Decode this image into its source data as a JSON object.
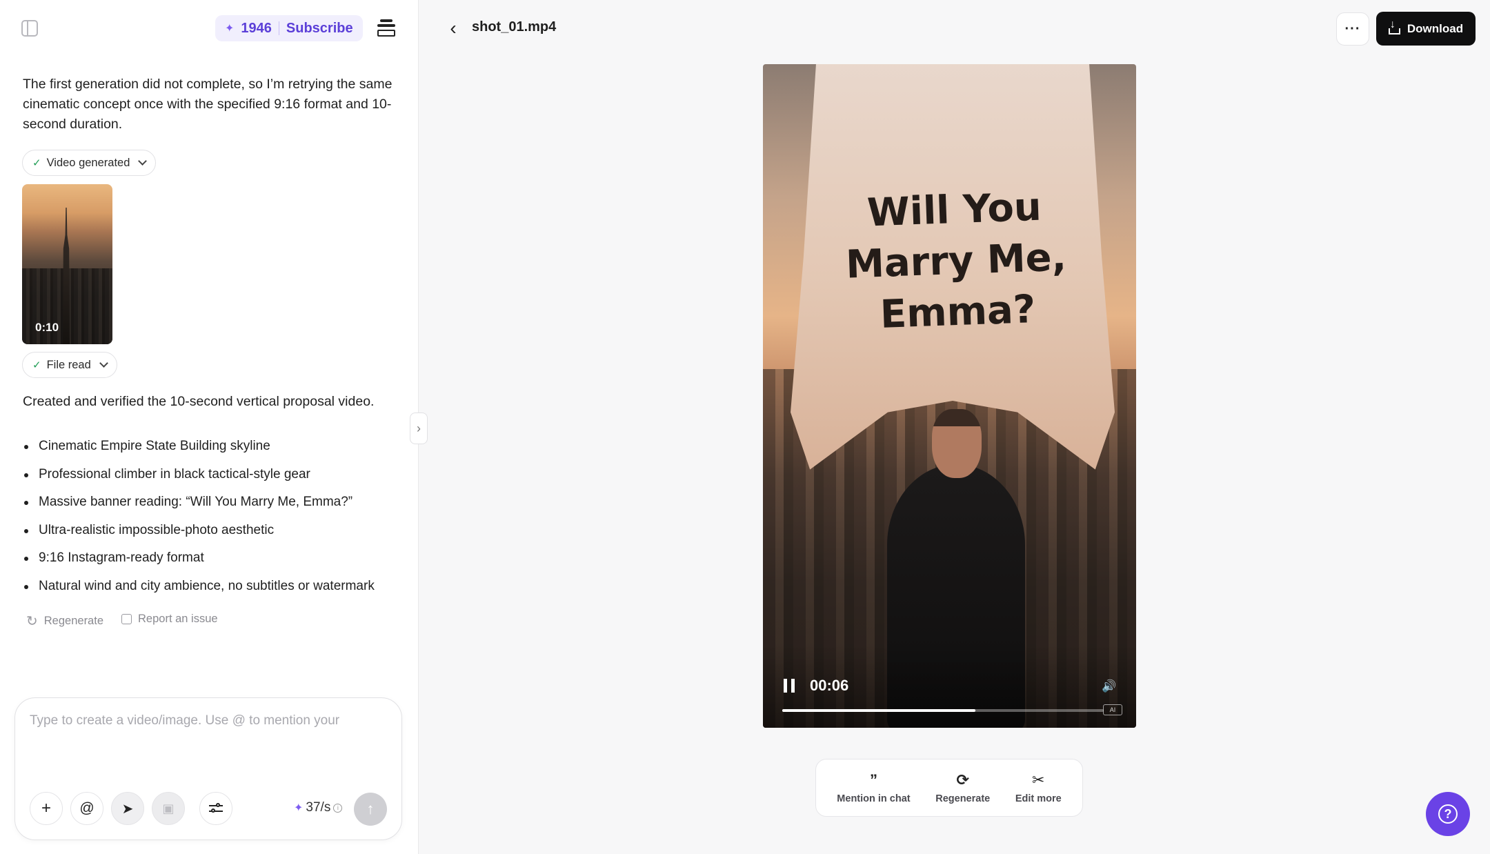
{
  "header": {
    "credits": "1946",
    "subscribe_label": "Subscribe"
  },
  "chat": {
    "message": "The first generation did not complete, so I’m retrying the same cinematic concept once with the specified 9:16 format and 10-second duration.",
    "chip_video_generated": "Video generated",
    "thumbnail_duration": "0:10",
    "chip_file_read": "File read",
    "summary": "Created and verified the 10-second vertical proposal video.",
    "bullets": [
      "Cinematic Empire State Building skyline",
      "Professional climber in black tactical-style gear",
      "Massive banner reading: “Will You Marry Me, Emma?”",
      "Ultra-realistic impossible-photo aesthetic",
      "9:16 Instagram-ready format",
      "Natural wind and city ambience, no subtitles or watermark"
    ],
    "regenerate_label": "Regenerate",
    "report_label": "Report an issue"
  },
  "composer": {
    "placeholder": "Type to create a video/image. Use @ to mention your",
    "value": "",
    "rate": "37/s"
  },
  "viewer": {
    "file_name": "shot_01.mp4",
    "download_label": "Download",
    "banner_line1": "Will You",
    "banner_line2": "Marry Me,",
    "banner_line3": "Emma?",
    "current_time": "00:06",
    "progress_fraction": 0.6,
    "ai_badge": "AI"
  },
  "actions": {
    "mention_label": "Mention in chat",
    "regenerate_label": "Regenerate",
    "edit_label": "Edit more"
  },
  "icons": [
    "sidebar-toggle-icon",
    "spark-icon",
    "stack-icon",
    "check-icon",
    "chevron-down-icon",
    "refresh-icon",
    "flag-icon",
    "plus-icon",
    "at-icon",
    "cursor-icon",
    "image-icon",
    "sliders-icon",
    "info-icon",
    "send-arrow-icon",
    "chevron-right-icon",
    "chevron-left-icon",
    "ellipsis-icon",
    "download-icon",
    "pause-icon",
    "volume-icon",
    "quote-icon",
    "scissors-icon",
    "help-icon"
  ],
  "colors": {
    "accent": "#5b3fd8",
    "fab": "#6a42e6",
    "download_bg": "#0f0f10",
    "success": "#1f9d55"
  }
}
